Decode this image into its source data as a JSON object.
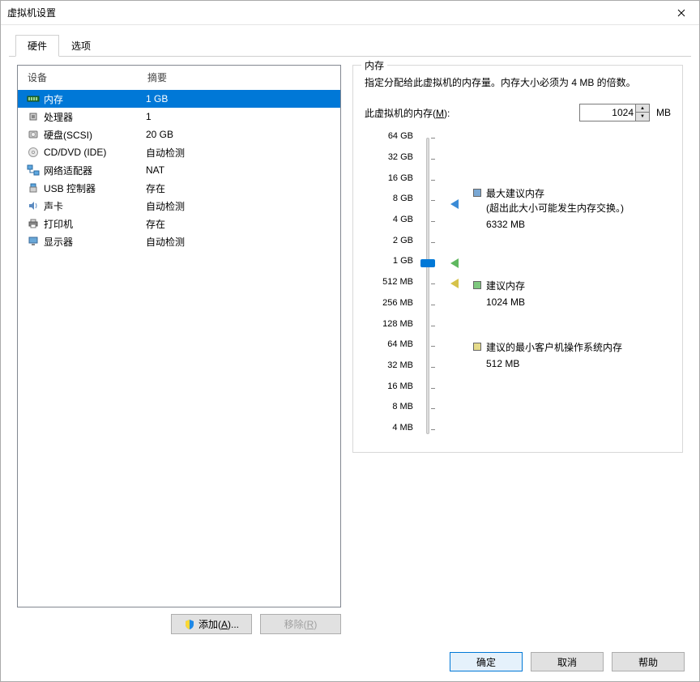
{
  "window": {
    "title": "虚拟机设置"
  },
  "tabs": {
    "hardware": "硬件",
    "options": "选项"
  },
  "headers": {
    "device": "设备",
    "summary": "摘要"
  },
  "devices": [
    {
      "icon": "memory-icon",
      "label": "内存",
      "summary": "1 GB",
      "selected": true
    },
    {
      "icon": "cpu-icon",
      "label": "处理器",
      "summary": "1"
    },
    {
      "icon": "disk-icon",
      "label": "硬盘(SCSI)",
      "summary": "20 GB"
    },
    {
      "icon": "cd-icon",
      "label": "CD/DVD (IDE)",
      "summary": "自动检测"
    },
    {
      "icon": "network-icon",
      "label": "网络适配器",
      "summary": "NAT"
    },
    {
      "icon": "usb-icon",
      "label": "USB 控制器",
      "summary": "存在"
    },
    {
      "icon": "sound-icon",
      "label": "声卡",
      "summary": "自动检测"
    },
    {
      "icon": "printer-icon",
      "label": "打印机",
      "summary": "存在"
    },
    {
      "icon": "display-icon",
      "label": "显示器",
      "summary": "自动检测"
    }
  ],
  "buttons": {
    "add_prefix": "添加(",
    "add_key": "A",
    "add_suffix": ")...",
    "remove_prefix": "移除(",
    "remove_key": "R",
    "remove_suffix": ")",
    "ok": "确定",
    "cancel": "取消",
    "help": "帮助"
  },
  "memory": {
    "legend": "内存",
    "desc": "指定分配给此虚拟机的内存量。内存大小必须为 4 MB 的倍数。",
    "label_prefix": "此虚拟机的内存(",
    "label_key": "M",
    "label_suffix": "):",
    "value": "1024",
    "unit": "MB",
    "ticks": [
      "64 GB",
      "32 GB",
      "16 GB",
      "8 GB",
      "4 GB",
      "2 GB",
      "1 GB",
      "512 MB",
      "256 MB",
      "128 MB",
      "64 MB",
      "32 MB",
      "16 MB",
      "8 MB",
      "4 MB"
    ],
    "max_rec_title": "最大建议内存",
    "max_rec_note": "(超出此大小可能发生内存交换。)",
    "max_rec_value": "6332 MB",
    "rec_title": "建议内存",
    "rec_value": "1024 MB",
    "min_title": "建议的最小客户机操作系统内存",
    "min_value": "512 MB"
  }
}
